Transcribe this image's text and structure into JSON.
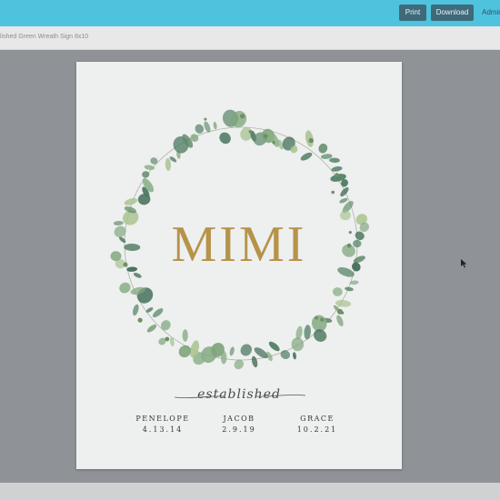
{
  "header": {
    "print_label": "Print",
    "download_label": "Download",
    "admin_label": "Admin"
  },
  "document": {
    "title": "lished Green Wreath Sign 8x10"
  },
  "sign": {
    "name": "MIMI",
    "established": "established",
    "children": [
      {
        "name": "PENELOPE",
        "date": "4.13.14"
      },
      {
        "name": "JACOB",
        "date": "2.9.19"
      },
      {
        "name": "GRACE",
        "date": "10.2.21"
      }
    ]
  },
  "colors": {
    "topbar": "#4fc3de",
    "button": "#3f6a7a",
    "gold": "#b59349",
    "leaf_dark": "#3f6b55",
    "leaf_light": "#a7c28d"
  }
}
